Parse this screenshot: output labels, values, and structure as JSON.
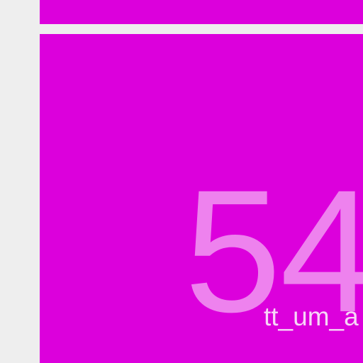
{
  "colors": {
    "background": "#eeeeee",
    "tile_fill": "#dc00dc",
    "value_text": "#ee82ee",
    "label_text": "#f7d6f7"
  },
  "tiles": [
    {
      "name": "tile-top"
    },
    {
      "name": "tile-main",
      "value": "54",
      "label": "tt_um_a"
    }
  ]
}
